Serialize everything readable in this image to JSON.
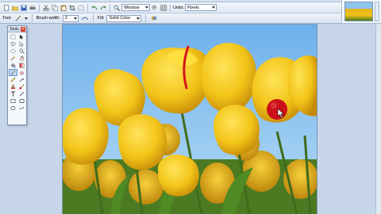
{
  "toolbar": {
    "window_combo": "Window",
    "units_label": "Units:",
    "units_value": "Pixels"
  },
  "options": {
    "tool_label": "Tool:",
    "brush_width_label": "Brush width:",
    "brush_width_value": "2",
    "fill_label": "Fill:",
    "fill_value": "Solid Color"
  },
  "tools_window": {
    "title": "Tools"
  },
  "colors": {
    "sky": "#8cc3ef",
    "petal": "#f2c418",
    "stem": "#3f6b1c",
    "cursor": "#d4141c"
  }
}
